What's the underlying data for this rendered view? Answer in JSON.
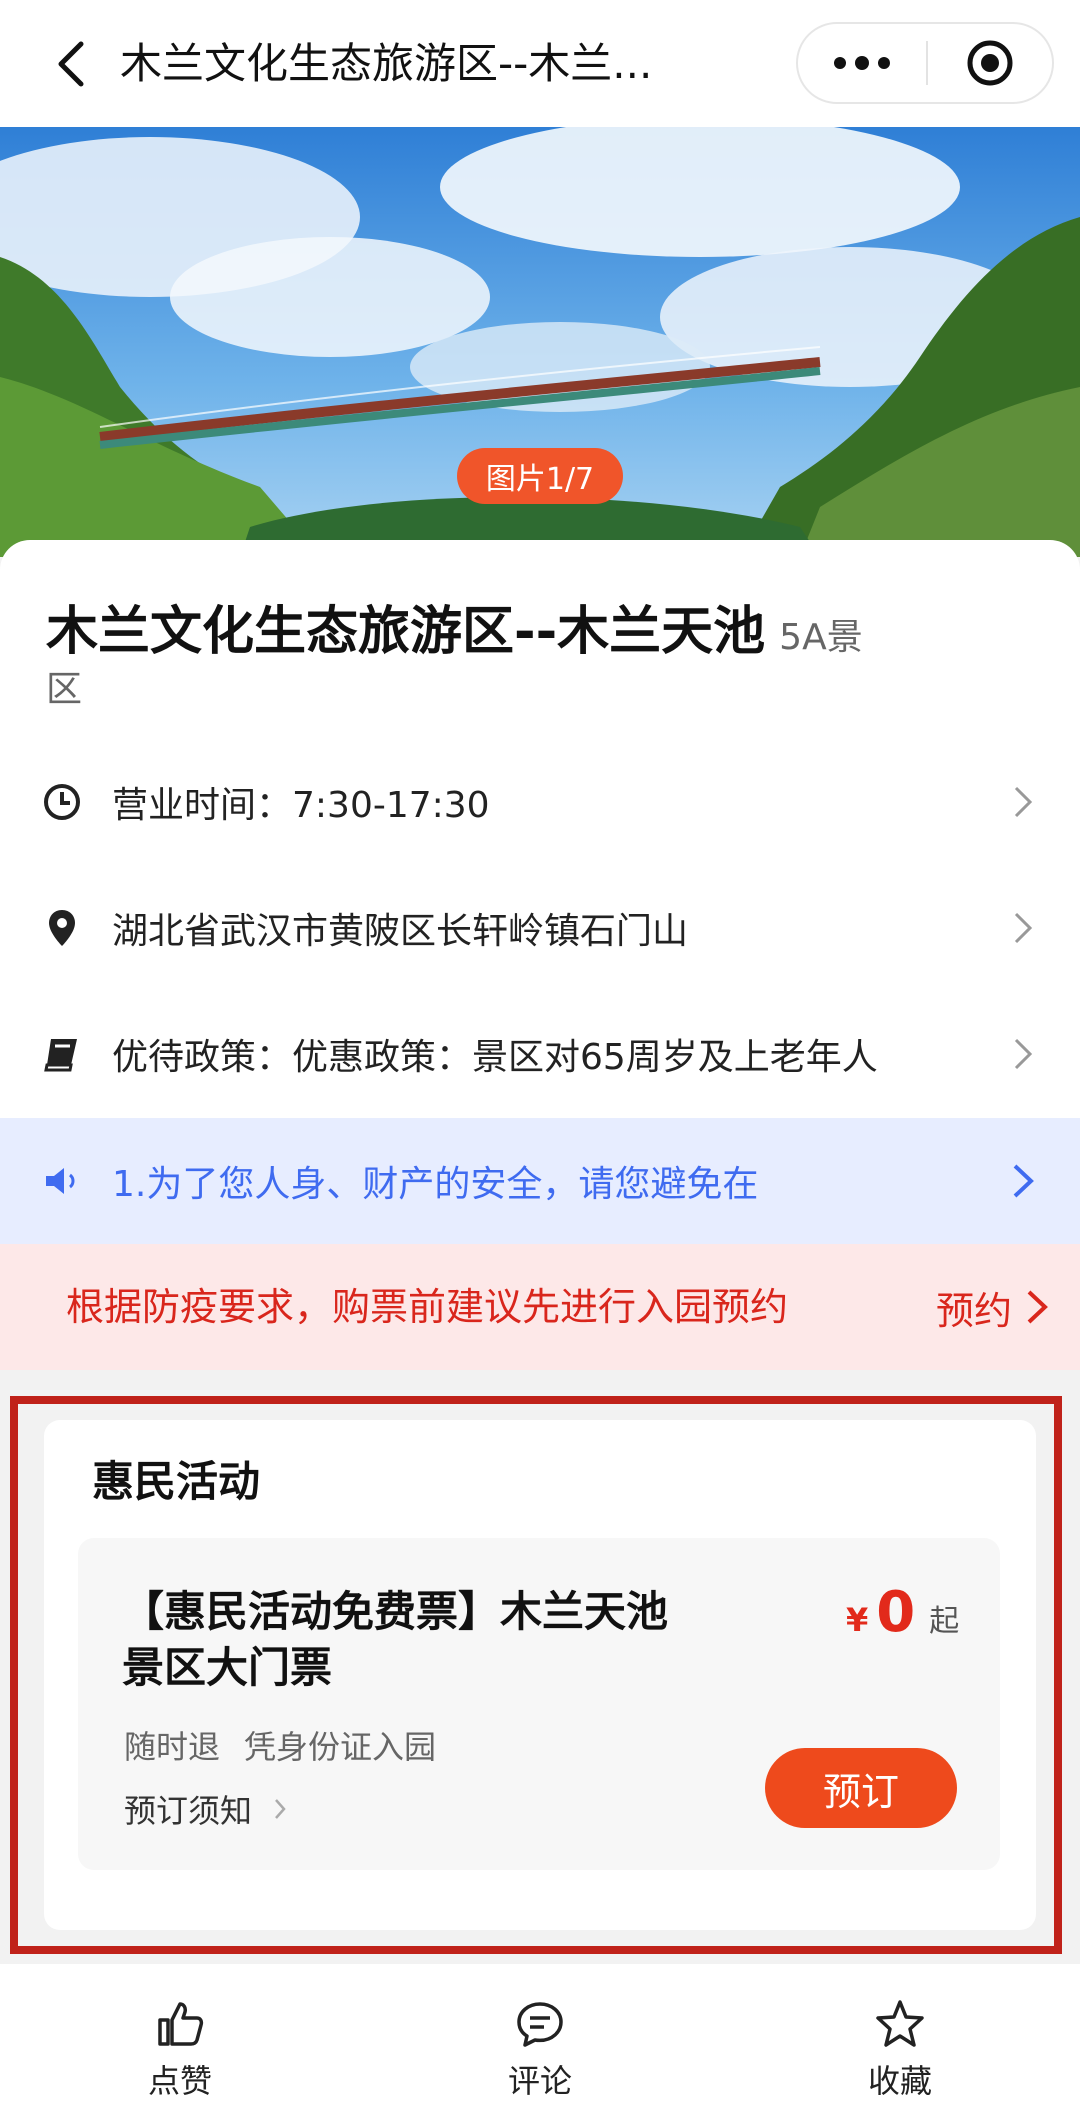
{
  "navbar": {
    "title": "木兰文化生态旅游区--木兰..."
  },
  "hero": {
    "photo_badge": "图片1/7"
  },
  "attraction": {
    "name": "木兰文化生态旅游区--木兰天池",
    "grade_line1": "5A景",
    "grade_line2": "区"
  },
  "info_rows": {
    "hours": "营业时间：7:30-17:30",
    "address": "湖北省武汉市黄陂区长轩岭镇石门山",
    "policy": "优待政策：优惠政策：景区对65周岁及上老年人"
  },
  "notice": {
    "announcement": "1.为了您人身、财产的安全，请您避免在",
    "epidemic": "根据防疫要求，购票前建议先进行入园预约",
    "reserve_label": "预约"
  },
  "promo": {
    "section_title": "惠民活动",
    "ticket": {
      "name": "【惠民活动免费票】木兰天池景区大门票",
      "currency": "¥",
      "price": "0",
      "price_suffix": "起",
      "tag_refund": "随时退",
      "tag_entry": "凭身份证入园",
      "notice_label": "预订须知",
      "book_label": "预订"
    }
  },
  "tabbar": {
    "like": "点赞",
    "comment": "评论",
    "favorite": "收藏"
  },
  "colors": {
    "accent_orange": "#ee4a1c",
    "price_red": "#e22a1b",
    "notice_blue": "#3f6bf0",
    "frame_red": "#c0221a"
  }
}
